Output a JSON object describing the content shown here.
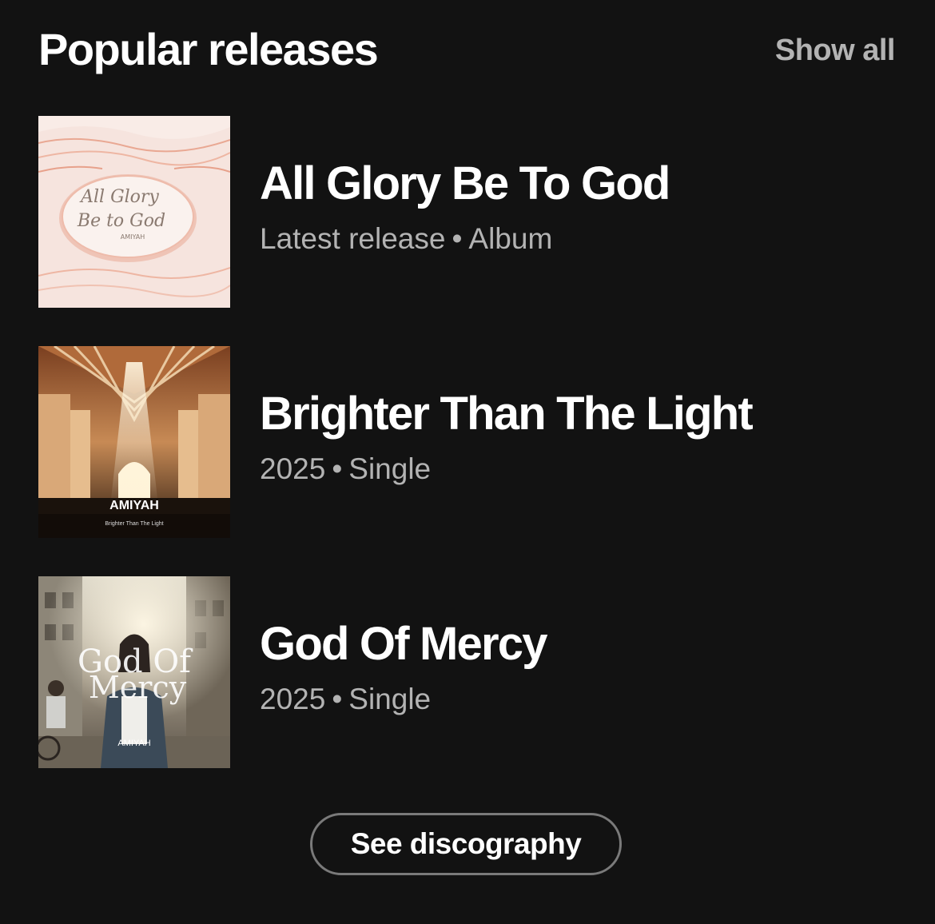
{
  "header": {
    "title": "Popular releases",
    "show_all_label": "Show all"
  },
  "releases": [
    {
      "title": "All Glory Be To God",
      "meta_prefix": "Latest release",
      "separator": "•",
      "meta_type": "Album",
      "cover": {
        "line1": "All Glory",
        "line2": "Be to God",
        "artist": "AMIYAH"
      }
    },
    {
      "title": "Brighter Than The Light",
      "meta_prefix": "2025",
      "separator": "•",
      "meta_type": "Single",
      "cover": {
        "artist": "AMIYAH",
        "subtitle": "Brighter Than The Light"
      }
    },
    {
      "title": "God Of Mercy",
      "meta_prefix": "2025",
      "separator": "•",
      "meta_type": "Single",
      "cover": {
        "line1": "God Of",
        "line2": "Mercy",
        "artist": "AMIYAH"
      }
    }
  ],
  "footer": {
    "discography_label": "See discography"
  },
  "colors": {
    "background": "#121212",
    "primary_text": "#ffffff",
    "secondary_text": "#b3b3b3",
    "button_border": "#7a7a7a"
  }
}
